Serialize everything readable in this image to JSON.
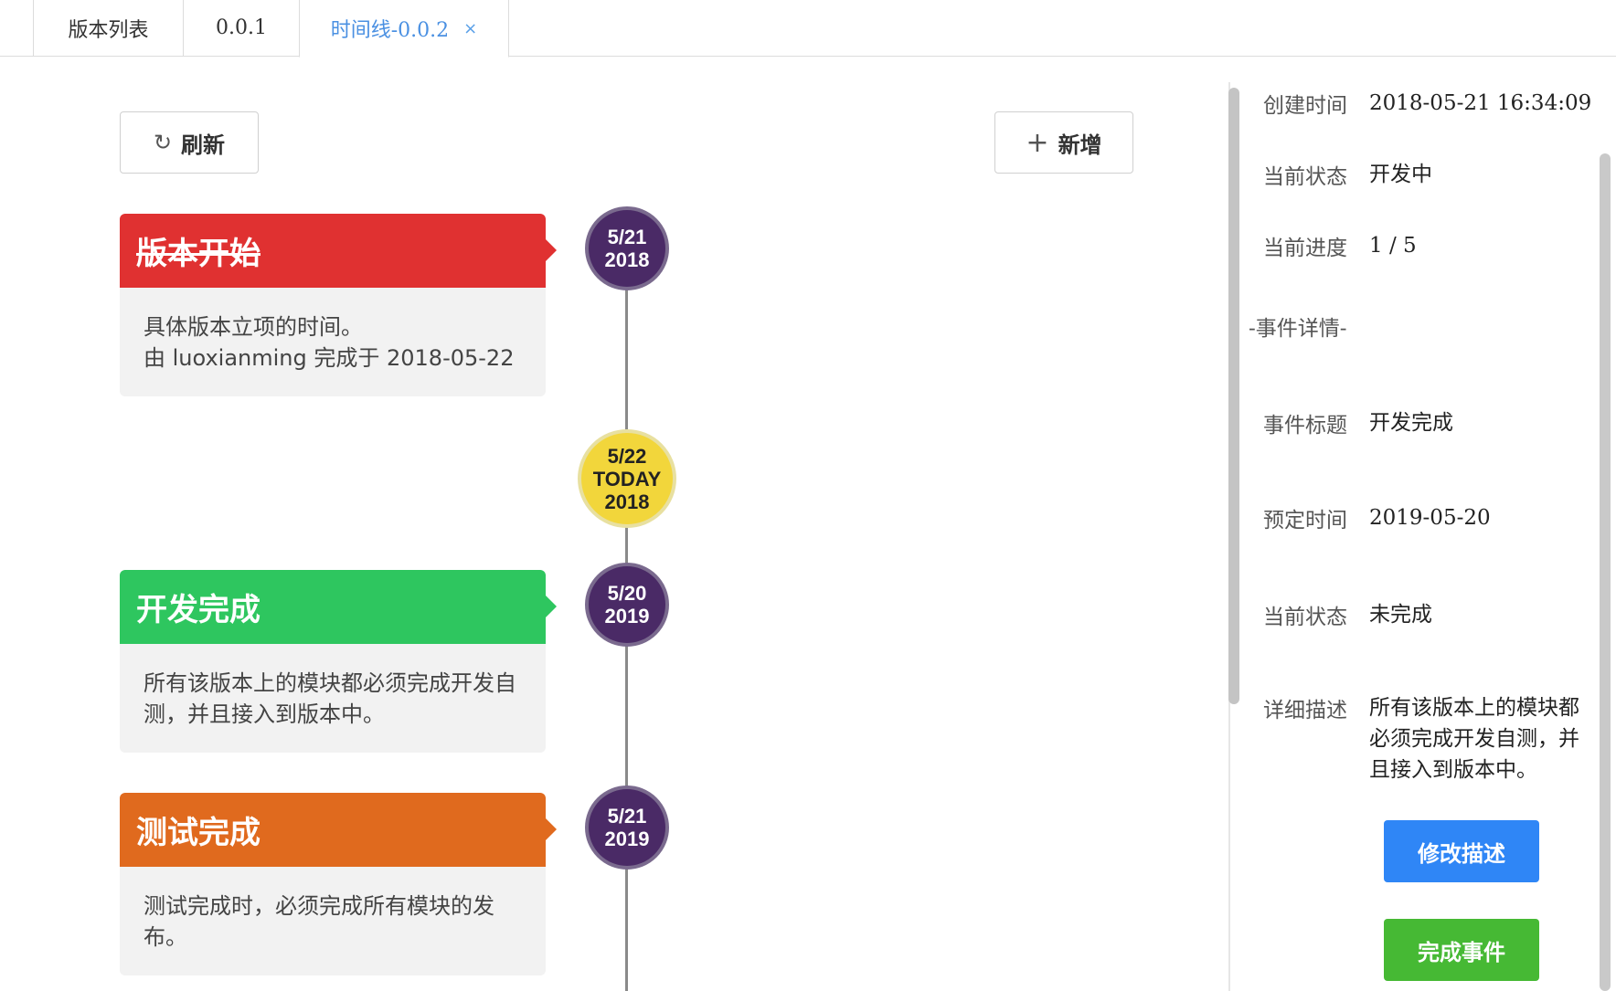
{
  "tabs": [
    {
      "label": "版本列表"
    },
    {
      "label": "0.0.1"
    },
    {
      "label": "时间线-0.0.2",
      "close": "×"
    }
  ],
  "toolbar": {
    "refresh_icon": "↻",
    "refresh_label": "刷新",
    "add_icon": "+",
    "add_label": "新增"
  },
  "timeline": {
    "events": [
      {
        "title": "版本开始",
        "color": "#e03131",
        "completed": true,
        "body": [
          "具体版本立项的时间。",
          "由 luoxianming 完成于 2018-05-22"
        ],
        "date": "5/21",
        "year": "2018"
      },
      {
        "title": "开发完成",
        "color": "#2ec65f",
        "completed": false,
        "body": [
          "所有该版本上的模块都必须完成开发自",
          "测，并且接入到版本中。"
        ],
        "date": "5/20",
        "year": "2019"
      },
      {
        "title": "测试完成",
        "color": "#e06a1e",
        "completed": false,
        "body": [
          "测试完成时，必须完成所有模块的发",
          "布。"
        ],
        "date": "5/21",
        "year": "2019"
      }
    ],
    "today": {
      "date": "5/22",
      "label": "TODAY",
      "year": "2018"
    }
  },
  "detail": {
    "created_label": "创建时间",
    "created_value": "2018-05-21 16:34:09",
    "status_label": "当前状态",
    "status_value": "开发中",
    "progress_label": "当前进度",
    "progress_value": "1 / 5",
    "section_title": "-事件详情-",
    "event_title_label": "事件标题",
    "event_title_value": "开发完成",
    "due_label": "预定时间",
    "due_value": "2019-05-20",
    "event_status_label": "当前状态",
    "event_status_value": "未完成",
    "desc_label": "详细描述",
    "desc_value": "所有该版本上的模块都必须完成开发自测，并且接入到版本中。",
    "edit_button": "修改描述",
    "complete_button": "完成事件",
    "edit_color": "#2f86f6",
    "complete_color": "#46b934"
  }
}
